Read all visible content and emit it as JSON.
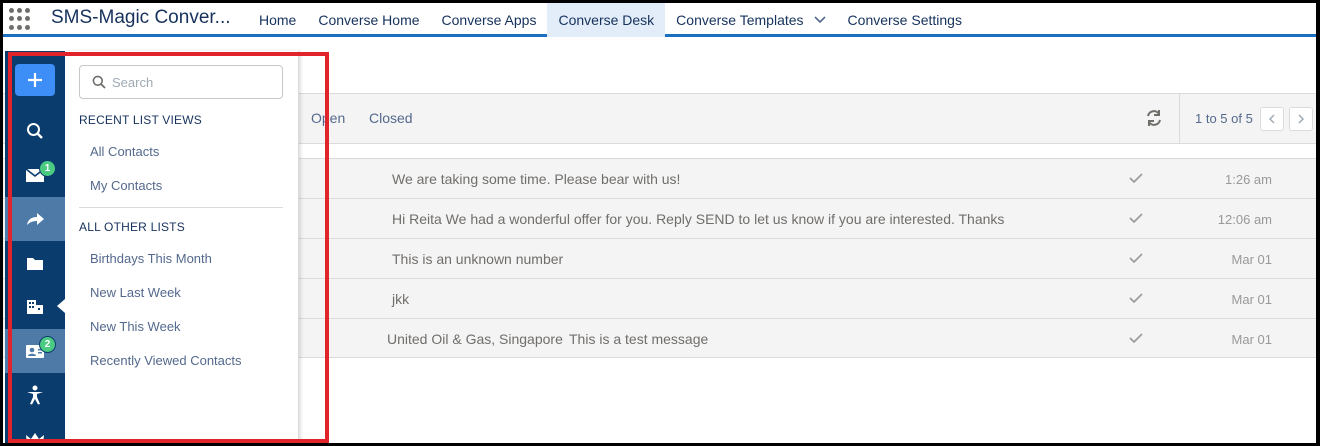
{
  "app": {
    "name": "SMS-Magic Conver..."
  },
  "nav": [
    {
      "label": "Home",
      "active": false
    },
    {
      "label": "Converse Home",
      "active": false
    },
    {
      "label": "Converse Apps",
      "active": false
    },
    {
      "label": "Converse Desk",
      "active": true
    },
    {
      "label": "Converse Templates",
      "active": false,
      "has_menu": true
    },
    {
      "label": "Converse Settings",
      "active": false
    }
  ],
  "toolbar": {
    "tab_open": "Open",
    "tab_closed": "Closed",
    "pagination": "1 to 5 of 5"
  },
  "messages": [
    {
      "contact": "",
      "text": "We are taking some time. Please bear with us!",
      "time": "1:26 am"
    },
    {
      "contact": "",
      "text": "Hi Reita We had a wonderful offer for you. Reply SEND to let us know if you are interested. Thanks",
      "time": "12:06 am"
    },
    {
      "contact": "",
      "text": "This is an unknown number",
      "time": "Mar 01"
    },
    {
      "contact": "",
      "text": "jkk",
      "time": "Mar 01"
    },
    {
      "contact": "United Oil & Gas, Singapore",
      "text": "This is a test message",
      "time": "Mar 01"
    }
  ],
  "rail": {
    "items": [
      {
        "icon": "plus-icon"
      },
      {
        "icon": "search-icon"
      },
      {
        "icon": "envelope-icon",
        "badge": "1"
      },
      {
        "icon": "share-arrow-icon",
        "active": true
      },
      {
        "icon": "folder-icon"
      },
      {
        "icon": "building-icon"
      },
      {
        "icon": "contact-card-icon",
        "badge": "2",
        "active": true
      },
      {
        "icon": "person-icon"
      },
      {
        "icon": "crown-icon"
      }
    ]
  },
  "panel": {
    "search_placeholder": "Search",
    "recent_title": "RECENT LIST VIEWS",
    "recent": [
      "All Contacts",
      "My Contacts"
    ],
    "other_title": "ALL OTHER LISTS",
    "other": [
      "Birthdays This Month",
      "New Last Week",
      "New This Week",
      "Recently Viewed Contacts"
    ]
  },
  "colors": {
    "brand_blue": "#1b6fc0",
    "rail_bg": "#0a3d6e",
    "badge_green": "#4bca81",
    "highlight_red": "#e1242c"
  }
}
